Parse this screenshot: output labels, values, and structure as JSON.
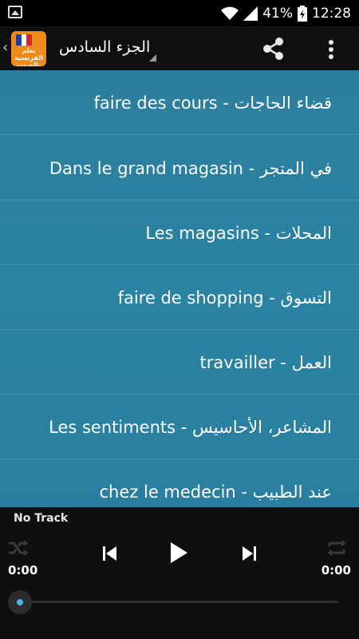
{
  "status_bar": {
    "battery_percent": "41%",
    "time": "12:28",
    "icons": [
      "image-notification-icon",
      "wifi-icon",
      "signal-icon",
      "battery-charging-icon"
    ]
  },
  "app_bar": {
    "title": "الجزء السادس",
    "logo": {
      "icon": "app-logo-icon",
      "text": "تعلم الفرنسية بالصوت",
      "flag_colors": [
        "#1f3f9a",
        "#ffffff",
        "#d9262c"
      ],
      "background": "#f08a1c"
    },
    "icons": [
      "back-chevron-icon",
      "share-icon",
      "overflow-menu-icon"
    ]
  },
  "lessons": [
    {
      "label": "faire des cours - قضاء الحاجات"
    },
    {
      "label": "Dans le grand magasin - في المتجر"
    },
    {
      "label": "Les magasins - المحلات"
    },
    {
      "label": "faire de shopping - التسوق"
    },
    {
      "label": "travailler - العمل"
    },
    {
      "label": "Les sentiments - المشاعر، الأحاسيس"
    },
    {
      "label": "chez le medecin - عند الطبيب"
    }
  ],
  "player": {
    "track": "No Track",
    "time_elapsed": "0:00",
    "time_total": "0:00",
    "progress_fraction": 0,
    "icons": [
      "shuffle-icon",
      "previous-icon",
      "play-icon",
      "next-icon",
      "repeat-icon"
    ]
  },
  "colors": {
    "list_background": "#2a80a1",
    "list_divider": "#3f95b3",
    "app_bar": "#101010",
    "player_background": "#0f0f0f",
    "seek_accent": "#4ab3e6"
  }
}
